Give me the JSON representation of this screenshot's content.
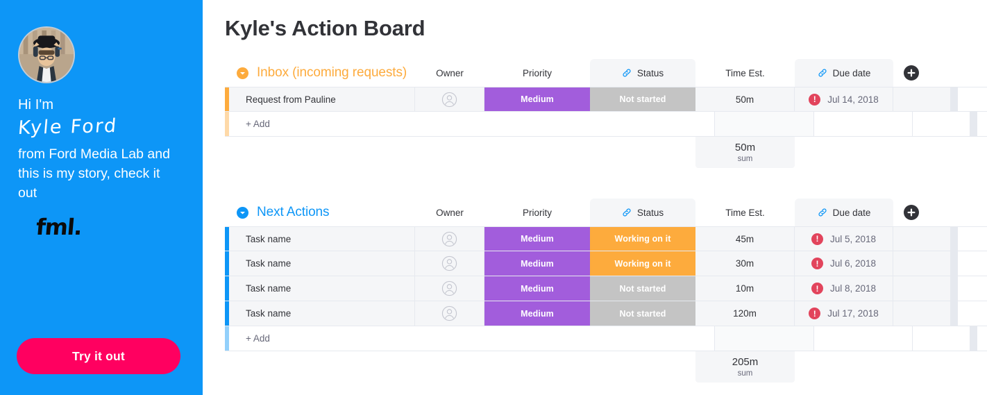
{
  "sidebar": {
    "avatar_alt": "profile-photo",
    "greeting": "Hi I'm",
    "name": "Kyle Ford",
    "blurb": "from Ford Media Lab and this is my story, check it out",
    "logo": "fml.",
    "cta_label": "Try it out",
    "bg_color": "#0d96f7",
    "cta_color": "#ff0060"
  },
  "board": {
    "title": "Kyle's Action Board",
    "add_column_label": "+",
    "groups": [
      {
        "name": "Inbox (incoming requests)",
        "color": "#fdab3d",
        "columns": [
          "Owner",
          "Priority",
          "Status",
          "Time Est.",
          "Due date"
        ],
        "rows": [
          {
            "title": "Request from Pauline",
            "owner": "unassigned",
            "priority": "Medium",
            "priority_color": "#a25ddc",
            "status": "Not started",
            "status_color": "#c4c4c4",
            "time": "50m",
            "due": "Jul 14, 2018",
            "overdue": true
          }
        ],
        "add_label": "+ Add",
        "sum_value": "50m",
        "sum_label": "sum"
      },
      {
        "name": "Next Actions",
        "color": "#0d96f7",
        "columns": [
          "Owner",
          "Priority",
          "Status",
          "Time Est.",
          "Due date"
        ],
        "rows": [
          {
            "title": "Task name",
            "owner": "unassigned",
            "priority": "Medium",
            "priority_color": "#a25ddc",
            "status": "Working on it",
            "status_color": "#fdab3d",
            "time": "45m",
            "due": "Jul 5, 2018",
            "overdue": true
          },
          {
            "title": "Task name",
            "owner": "unassigned",
            "priority": "Medium",
            "priority_color": "#a25ddc",
            "status": "Working on it",
            "status_color": "#fdab3d",
            "time": "30m",
            "due": "Jul 6, 2018",
            "overdue": true
          },
          {
            "title": "Task name",
            "owner": "unassigned",
            "priority": "Medium",
            "priority_color": "#a25ddc",
            "status": "Not started",
            "status_color": "#c4c4c4",
            "time": "10m",
            "due": "Jul 8, 2018",
            "overdue": true
          },
          {
            "title": "Task name",
            "owner": "unassigned",
            "priority": "Medium",
            "priority_color": "#a25ddc",
            "status": "Not started",
            "status_color": "#c4c4c4",
            "time": "120m",
            "due": "Jul 17, 2018",
            "overdue": true
          }
        ],
        "add_label": "+ Add",
        "sum_value": "205m",
        "sum_label": "sum"
      }
    ]
  }
}
